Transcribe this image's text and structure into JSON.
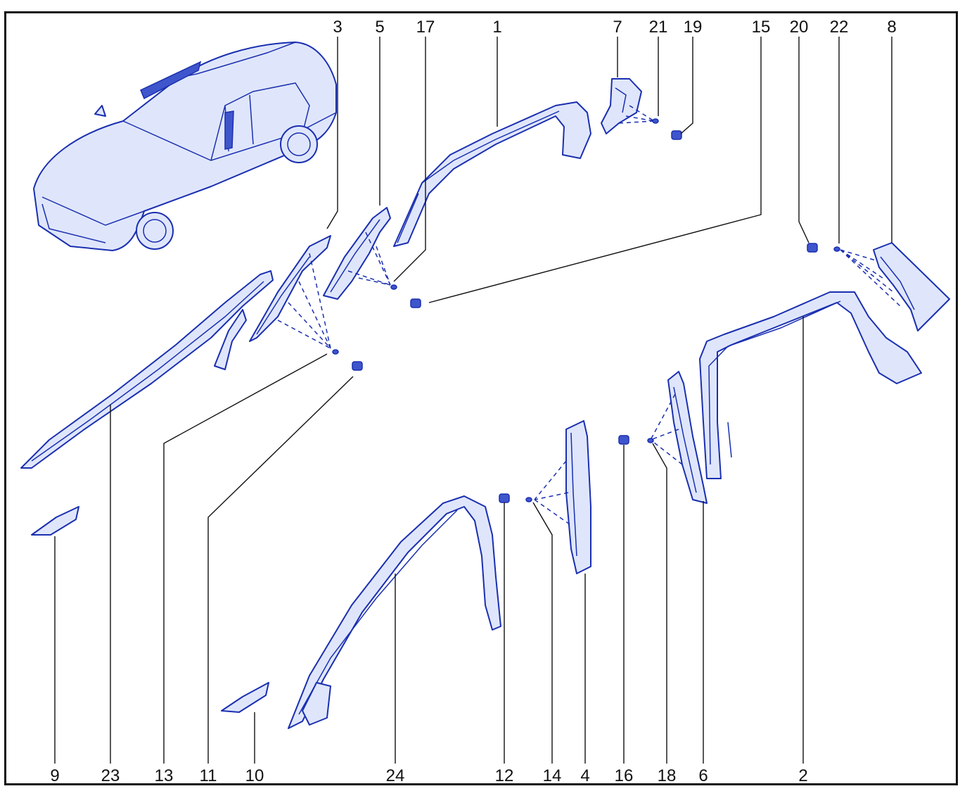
{
  "diagram": {
    "callouts": {
      "top": [
        "3",
        "5",
        "17",
        "1",
        "7",
        "21",
        "19",
        "15",
        "20",
        "22",
        "8"
      ],
      "bottom": [
        "9",
        "23",
        "13",
        "11",
        "10",
        "24",
        "12",
        "14",
        "4",
        "16",
        "18",
        "6",
        "2"
      ]
    },
    "colors": {
      "line_art": "#1a2fb0",
      "part_fill": "#dfe6fb",
      "callout_text": "#111111",
      "frame": "#111111"
    },
    "illustration": "car-side-trim-exploded-view"
  }
}
